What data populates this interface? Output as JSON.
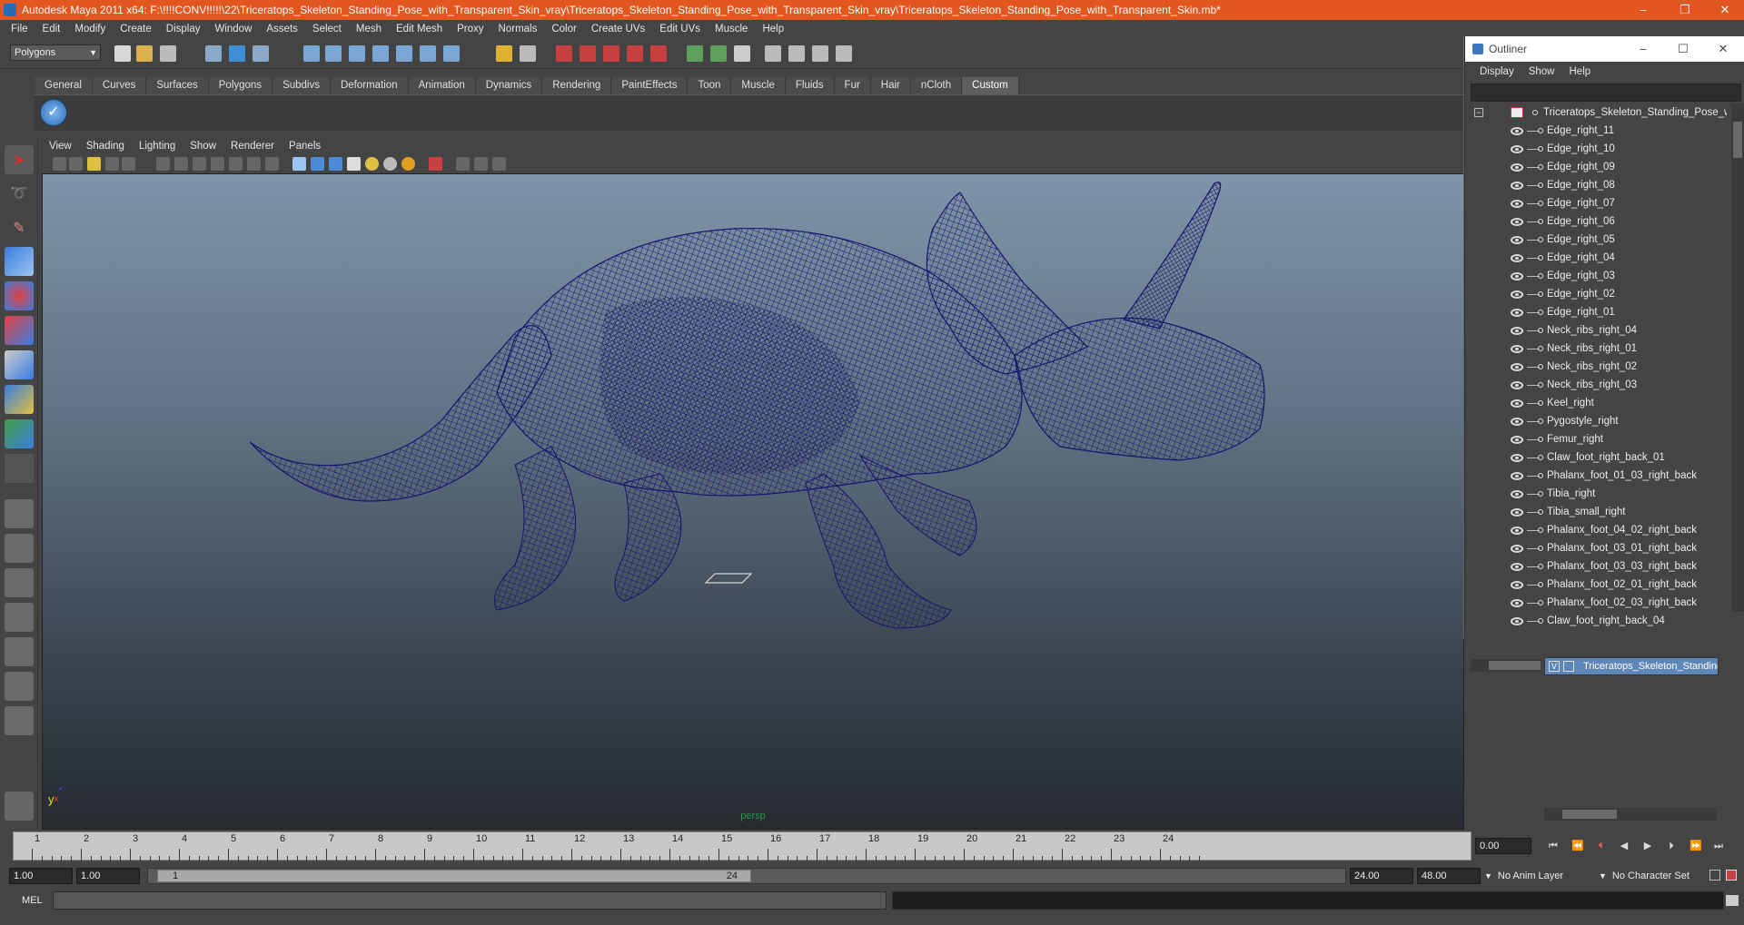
{
  "window": {
    "title": "Autodesk Maya 2011 x64: F:\\!!!!CONV!!!!!\\22\\Triceratops_Skeleton_Standing_Pose_with_Transparent_Skin_vray\\Triceratops_Skeleton_Standing_Pose_with_Transparent_Skin_vray\\Triceratops_Skeleton_Standing_Pose_with_Transparent_Skin.mb*",
    "title_bar_color": "#e2571f",
    "minimize": "–",
    "maximize": "❐",
    "close": "✕"
  },
  "menubar": [
    "File",
    "Edit",
    "Modify",
    "Create",
    "Display",
    "Window",
    "Assets",
    "Select",
    "Mesh",
    "Edit Mesh",
    "Proxy",
    "Normals",
    "Color",
    "Create UVs",
    "Edit UVs",
    "Muscle",
    "Help"
  ],
  "statusline": {
    "mode": "Polygons"
  },
  "shelf": {
    "tabs": [
      "General",
      "Curves",
      "Surfaces",
      "Polygons",
      "Subdivs",
      "Deformation",
      "Animation",
      "Dynamics",
      "Rendering",
      "PaintEffects",
      "Toon",
      "Muscle",
      "Fluids",
      "Fur",
      "Hair",
      "nCloth",
      "Custom"
    ],
    "active_tab": "Custom"
  },
  "panel": {
    "menus": [
      "View",
      "Shading",
      "Lighting",
      "Show",
      "Renderer",
      "Panels"
    ],
    "camera_label": "persp",
    "axis": {
      "y": "y",
      "x": "x"
    },
    "wireframe_color": "#14156e"
  },
  "outliner": {
    "title": "Outliner",
    "menus": [
      "Display",
      "Show",
      "Help"
    ],
    "minimize": "–",
    "maximize": "☐",
    "close": "✕",
    "root": "Triceratops_Skeleton_Standing_Pose_with_T",
    "items": [
      "Edge_right_11",
      "Edge_right_10",
      "Edge_right_09",
      "Edge_right_08",
      "Edge_right_07",
      "Edge_right_06",
      "Edge_right_05",
      "Edge_right_04",
      "Edge_right_03",
      "Edge_right_02",
      "Edge_right_01",
      "Neck_ribs_right_04",
      "Neck_ribs_right_01",
      "Neck_ribs_right_02",
      "Neck_ribs_right_03",
      "Keel_right",
      "Pygostyle_right",
      "Femur_right",
      "Claw_foot_right_back_01",
      "Phalanx_foot_01_03_right_back",
      "Tibia_right",
      "Tibia_small_right",
      "Phalanx_foot_04_02_right_back",
      "Phalanx_foot_03_01_right_back",
      "Phalanx_foot_03_03_right_back",
      "Phalanx_foot_02_01_right_back",
      "Phalanx_foot_02_03_right_back",
      "Claw_foot_right_back_04"
    ]
  },
  "layer_editor": {
    "layer_name": "Triceratops_Skeleton_Standing",
    "visible_flag": "V"
  },
  "time_slider": {
    "ticks": [
      "1",
      "2",
      "3",
      "4",
      "5",
      "6",
      "7",
      "8",
      "9",
      "10",
      "11",
      "12",
      "13",
      "14",
      "15",
      "16",
      "17",
      "18",
      "19",
      "20",
      "21",
      "22",
      "23",
      "24"
    ],
    "current_frame": "0.00"
  },
  "range": {
    "start": "1.00",
    "playback_start": "1.00",
    "handle_start": "1",
    "handle_end": "24",
    "playback_end": "24.00",
    "end": "48.00",
    "anim_layer": "No Anim Layer",
    "character_set": "No Character Set"
  },
  "command_line": {
    "label": "MEL"
  }
}
